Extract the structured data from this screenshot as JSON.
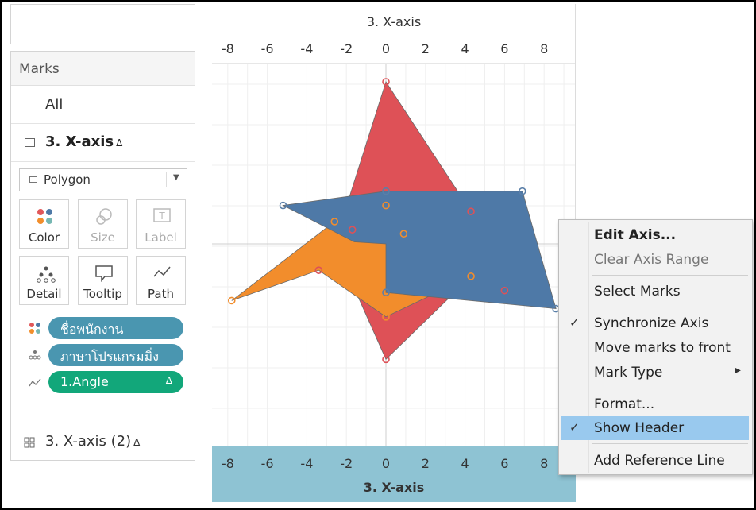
{
  "left_panel": {
    "marks_title": "Marks",
    "all_label": "All",
    "sheet_label": "3. X-axis",
    "delta": "Δ",
    "mark_type": "Polygon",
    "buttons": [
      {
        "label": "Color",
        "enabled": true,
        "icon": "color-icon"
      },
      {
        "label": "Size",
        "enabled": false,
        "icon": "size-icon"
      },
      {
        "label": "Label",
        "enabled": false,
        "icon": "label-icon"
      },
      {
        "label": "Detail",
        "enabled": true,
        "icon": "detail-icon"
      },
      {
        "label": "Tooltip",
        "enabled": true,
        "icon": "tooltip-icon"
      },
      {
        "label": "Path",
        "enabled": true,
        "icon": "path-icon"
      }
    ],
    "pills": [
      {
        "text": "ชื่อพนักงาน",
        "color": "#4a96b0",
        "icon": "color-dots-icon"
      },
      {
        "text": "ภาษาโปรแกรมมิ่ง",
        "color": "#4a96b0",
        "icon": "detail-dots-icon"
      },
      {
        "text": "1.Angle",
        "color": "#12a77a",
        "icon": "path-line-icon",
        "delta": "Δ"
      }
    ],
    "second_sheet_label": "3. X-axis (2)"
  },
  "chart_data": {
    "type": "polygon",
    "title": "",
    "xlabel": "3. X-axis",
    "x_ticks": [
      -8,
      -6,
      -4,
      -2,
      0,
      2,
      4,
      6,
      8
    ],
    "xlim": [
      -9.6,
      9.6
    ],
    "grid": true,
    "series": [
      {
        "color": "#de5157",
        "points": [
          [
            0,
            8
          ],
          [
            4.3,
            1.6
          ],
          [
            6,
            0
          ],
          [
            0,
            -5.7
          ],
          [
            -2.6,
            0
          ]
        ]
      },
      {
        "color": "#f28d2c",
        "points": [
          [
            -7.8,
            -2.8
          ],
          [
            -2.6,
            1.1
          ],
          [
            0.9,
            0.5
          ],
          [
            4.3,
            -1.6
          ],
          [
            0,
            -3.6
          ],
          [
            -3.4,
            -1.3
          ]
        ]
      },
      {
        "color": "#4e79a7",
        "points": [
          [
            -5.2,
            1.9
          ],
          [
            0,
            2.6
          ],
          [
            6.9,
            2.6
          ],
          [
            8.6,
            -3.2
          ],
          [
            0,
            -2.4
          ],
          [
            0,
            0
          ],
          [
            -1.6,
            0.1
          ]
        ]
      }
    ],
    "markers": [
      {
        "x": 0,
        "y": 8,
        "color": "#de5157"
      },
      {
        "x": 0,
        "y": 2.6,
        "color": "#5a7fa8"
      },
      {
        "x": 0,
        "y": 1.9,
        "color": "#f28d2c"
      },
      {
        "x": 4.3,
        "y": 1.6,
        "color": "#de5157"
      },
      {
        "x": -2.6,
        "y": 1.1,
        "color": "#f28d2c"
      },
      {
        "x": -1.7,
        "y": 0.7,
        "color": "#de5157"
      },
      {
        "x": 0.9,
        "y": 0.5,
        "color": "#f28d2c"
      },
      {
        "x": -3.4,
        "y": -1.3,
        "color": "#de5157"
      },
      {
        "x": 4.3,
        "y": -1.6,
        "color": "#f28d2c"
      },
      {
        "x": 6,
        "y": -2.3,
        "color": "#de5157"
      },
      {
        "x": 0,
        "y": -2.4,
        "color": "#5a7fa8"
      },
      {
        "x": -7.8,
        "y": -2.8,
        "color": "#f28d2c"
      },
      {
        "x": 0,
        "y": -3.6,
        "color": "#f28d2c"
      },
      {
        "x": 0,
        "y": -5.7,
        "color": "#de5157"
      },
      {
        "x": -5.2,
        "y": 1.9,
        "color": "#5a7fa8"
      },
      {
        "x": 6.9,
        "y": 2.6,
        "color": "#5a7fa8"
      },
      {
        "x": 8.6,
        "y": -3.2,
        "color": "#5a7fa8"
      }
    ]
  },
  "context_menu": {
    "items": [
      {
        "label": "Edit Axis...",
        "style": "bold"
      },
      {
        "label": "Clear Axis Range",
        "style": "disabled"
      },
      {
        "label": "Select Marks",
        "style": "normal"
      },
      {
        "label": "Synchronize Axis",
        "style": "normal",
        "checked": true
      },
      {
        "label": "Move marks to front",
        "style": "normal"
      },
      {
        "label": "Mark Type",
        "style": "normal",
        "submenu": true
      },
      {
        "label": "Format...",
        "style": "normal"
      },
      {
        "label": "Show Header",
        "style": "selected",
        "checked": true
      },
      {
        "label": "Add Reference Line",
        "style": "normal"
      }
    ],
    "check_glyph": "✓",
    "submenu_glyph": "▶"
  }
}
